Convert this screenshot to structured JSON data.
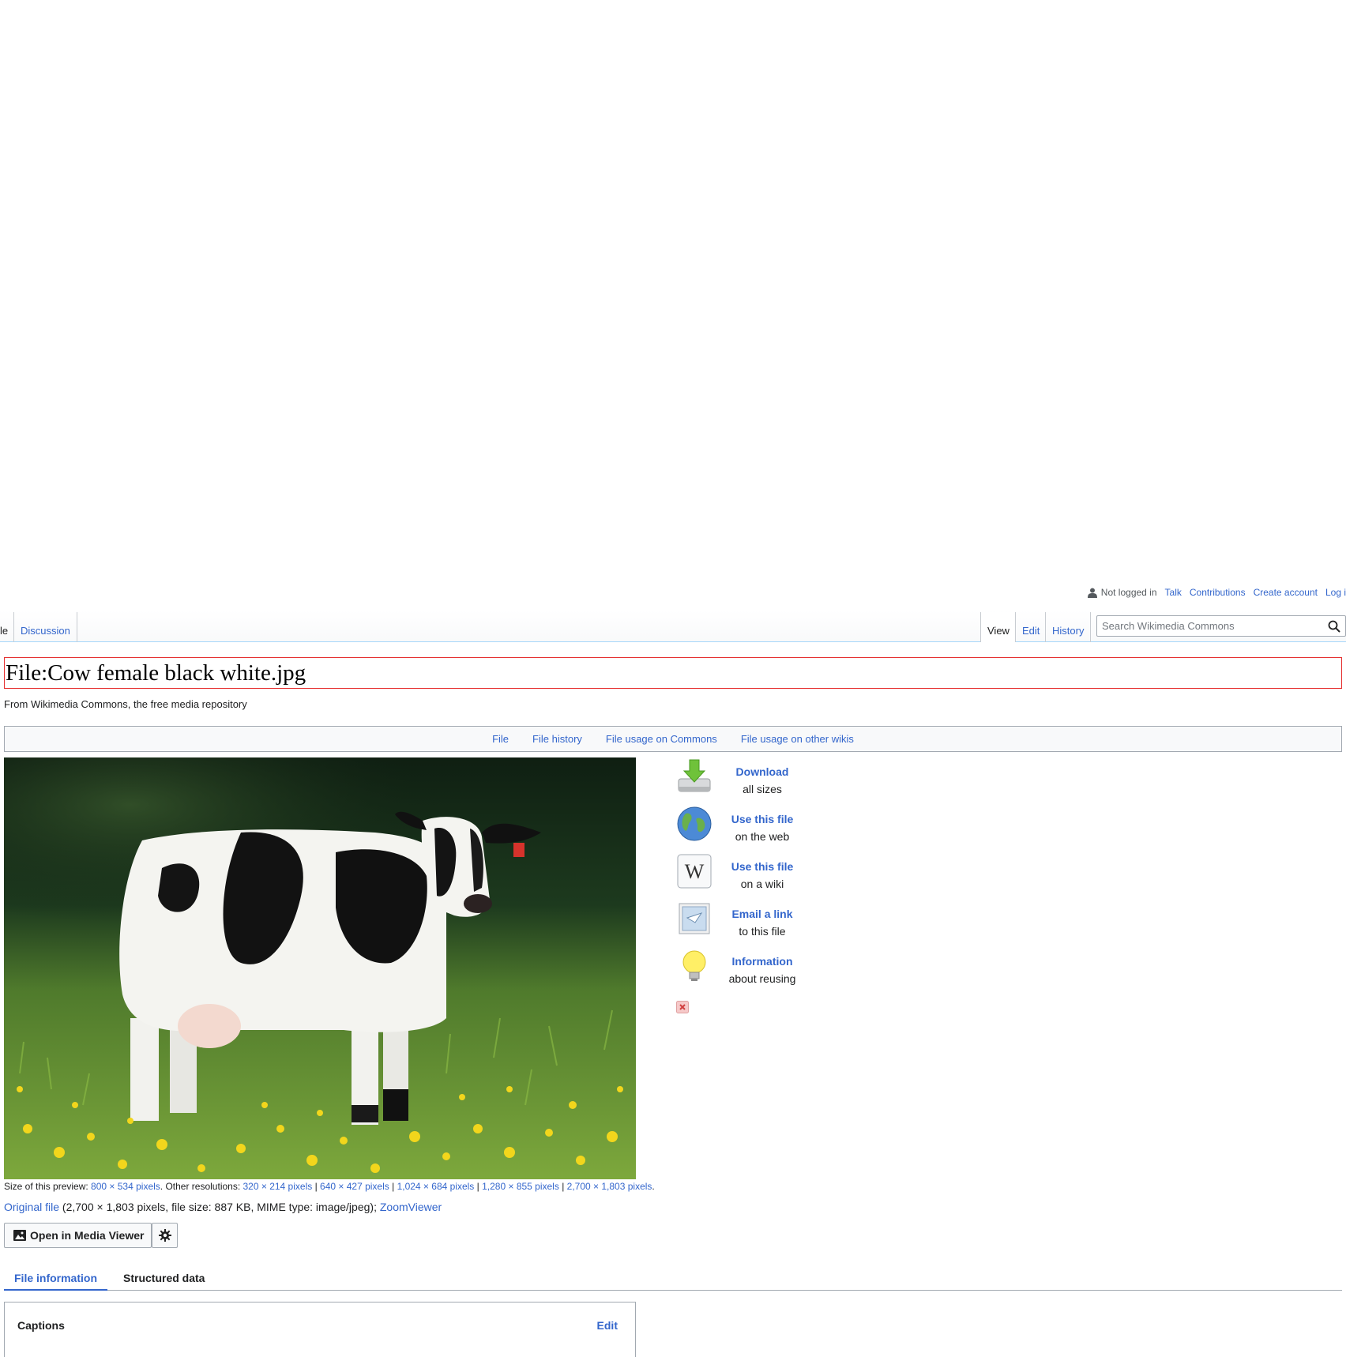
{
  "personal": {
    "not_logged_in": "Not logged in",
    "talk": "Talk",
    "contributions": "Contributions",
    "create_account": "Create account",
    "log_in": "Log i"
  },
  "tabs": {
    "page": "le",
    "discussion": "Discussion",
    "view": "View",
    "edit": "Edit",
    "history": "History"
  },
  "search": {
    "placeholder": "Search Wikimedia Commons",
    "icon": "search-icon"
  },
  "page": {
    "title": "File:Cow female black white.jpg",
    "tagline": "From Wikimedia Commons, the free media repository"
  },
  "filetoc": [
    "File",
    "File history",
    "File usage on Commons",
    "File usage on other wikis"
  ],
  "actions": [
    {
      "icon": "download-icon",
      "title": "Download",
      "subtitle": "all sizes"
    },
    {
      "icon": "globe-icon",
      "title": "Use this file",
      "subtitle": "on the web"
    },
    {
      "icon": "wikipedia-icon",
      "title": "Use this file",
      "subtitle": "on a wiki"
    },
    {
      "icon": "email-icon",
      "title": "Email a link",
      "subtitle": "to this file"
    },
    {
      "icon": "lightbulb-icon",
      "title": "Information",
      "subtitle": "about reusing"
    }
  ],
  "sizes": {
    "prefix": "Size of this preview: ",
    "preview": "800 × 534 pixels",
    "other": ". Other resolutions: ",
    "res1": "320 × 214 pixels",
    "res2": "640 × 427 pixels",
    "res3": "1,024 × 684 pixels",
    "res4": "1,280 × 855 pixels",
    "res5": "2,700 × 1,803 pixels",
    "sep": " | ",
    "end": "."
  },
  "fullinfo": {
    "original": "Original file",
    "details": " (2,700 × 1,803 pixels, file size: 887 KB, MIME type: image/jpeg); ",
    "zoom": "ZoomViewer"
  },
  "buttons": {
    "media_viewer": "Open in Media Viewer",
    "settings_icon": "gear-icon"
  },
  "lower_tabs": {
    "file_information": "File information",
    "structured_data": "Structured data"
  },
  "captions": {
    "heading": "Captions",
    "edit": "Edit"
  },
  "colors": {
    "link": "#3366cc",
    "title_border": "#e52f2f",
    "tab_border": "#a7d7f9"
  }
}
